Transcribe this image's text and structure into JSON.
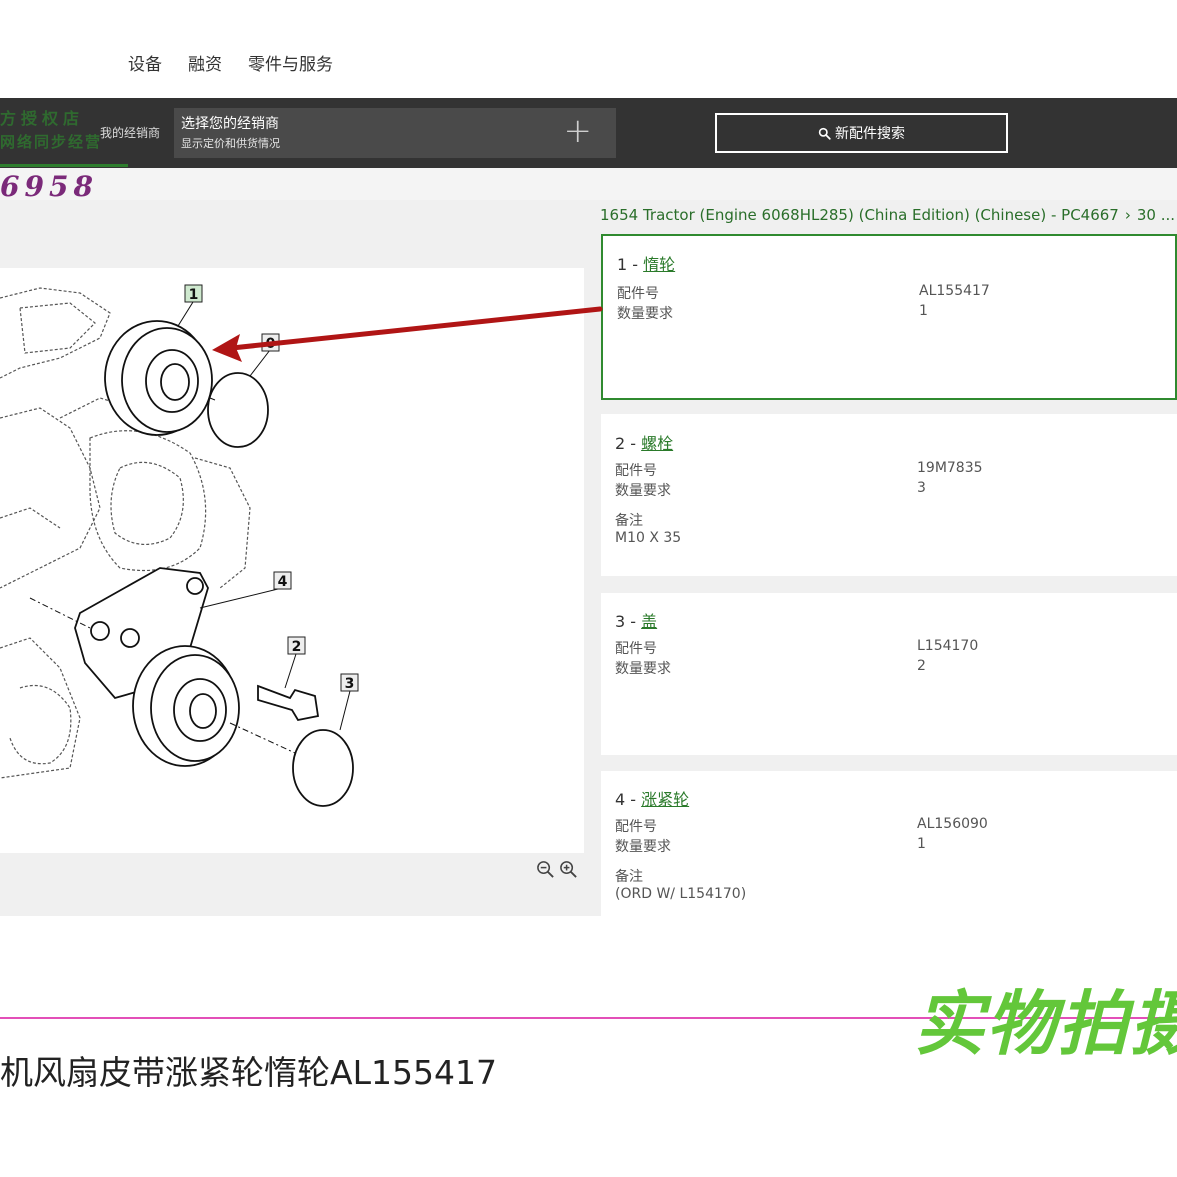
{
  "nav": {
    "items": [
      "设备",
      "融资",
      "零件与服务"
    ]
  },
  "toolbar": {
    "watermark_line1": "方授权店",
    "watermark_line2": "网络同步经营",
    "dealer_label": "我的经销商",
    "dealer_title": "选择您的经销商",
    "dealer_subtitle": "显示定价和供货情况",
    "plus_icon": "+",
    "search_label": "新配件搜索"
  },
  "watermark_digits": "6958",
  "breadcrumb": {
    "path": "1654 Tractor (Engine 6068HL285) (China Edition) (Chinese) - PC4667",
    "next": "30 ..."
  },
  "diagram": {
    "callouts": [
      "1",
      "0",
      "4",
      "2",
      "3"
    ]
  },
  "labels": {
    "part_no": "配件号",
    "qty": "数量要求",
    "note": "备注"
  },
  "parts": [
    {
      "num": "1 - ",
      "name": "惰轮",
      "part_no": "AL155417",
      "qty": "1",
      "note": ""
    },
    {
      "num": "2 - ",
      "name": "螺栓",
      "part_no": "19M7835",
      "qty": "3",
      "note": "M10 X 35"
    },
    {
      "num": "3 - ",
      "name": "盖",
      "part_no": "L154170",
      "qty": "2",
      "note": ""
    },
    {
      "num": "4 - ",
      "name": "涨紧轮",
      "part_no": "AL156090",
      "qty": "1",
      "note": "(ORD W/ L154170)"
    }
  ],
  "watermark_photo": "实物拍摄",
  "product_title": "机风扇皮带涨紧轮惰轮AL155417",
  "colors": {
    "accent_green": "#2a7a2a",
    "dark_bar": "#333333",
    "arrow_red": "#b01515",
    "pink_line": "#e34fb8",
    "photo_green": "#63c73a"
  }
}
